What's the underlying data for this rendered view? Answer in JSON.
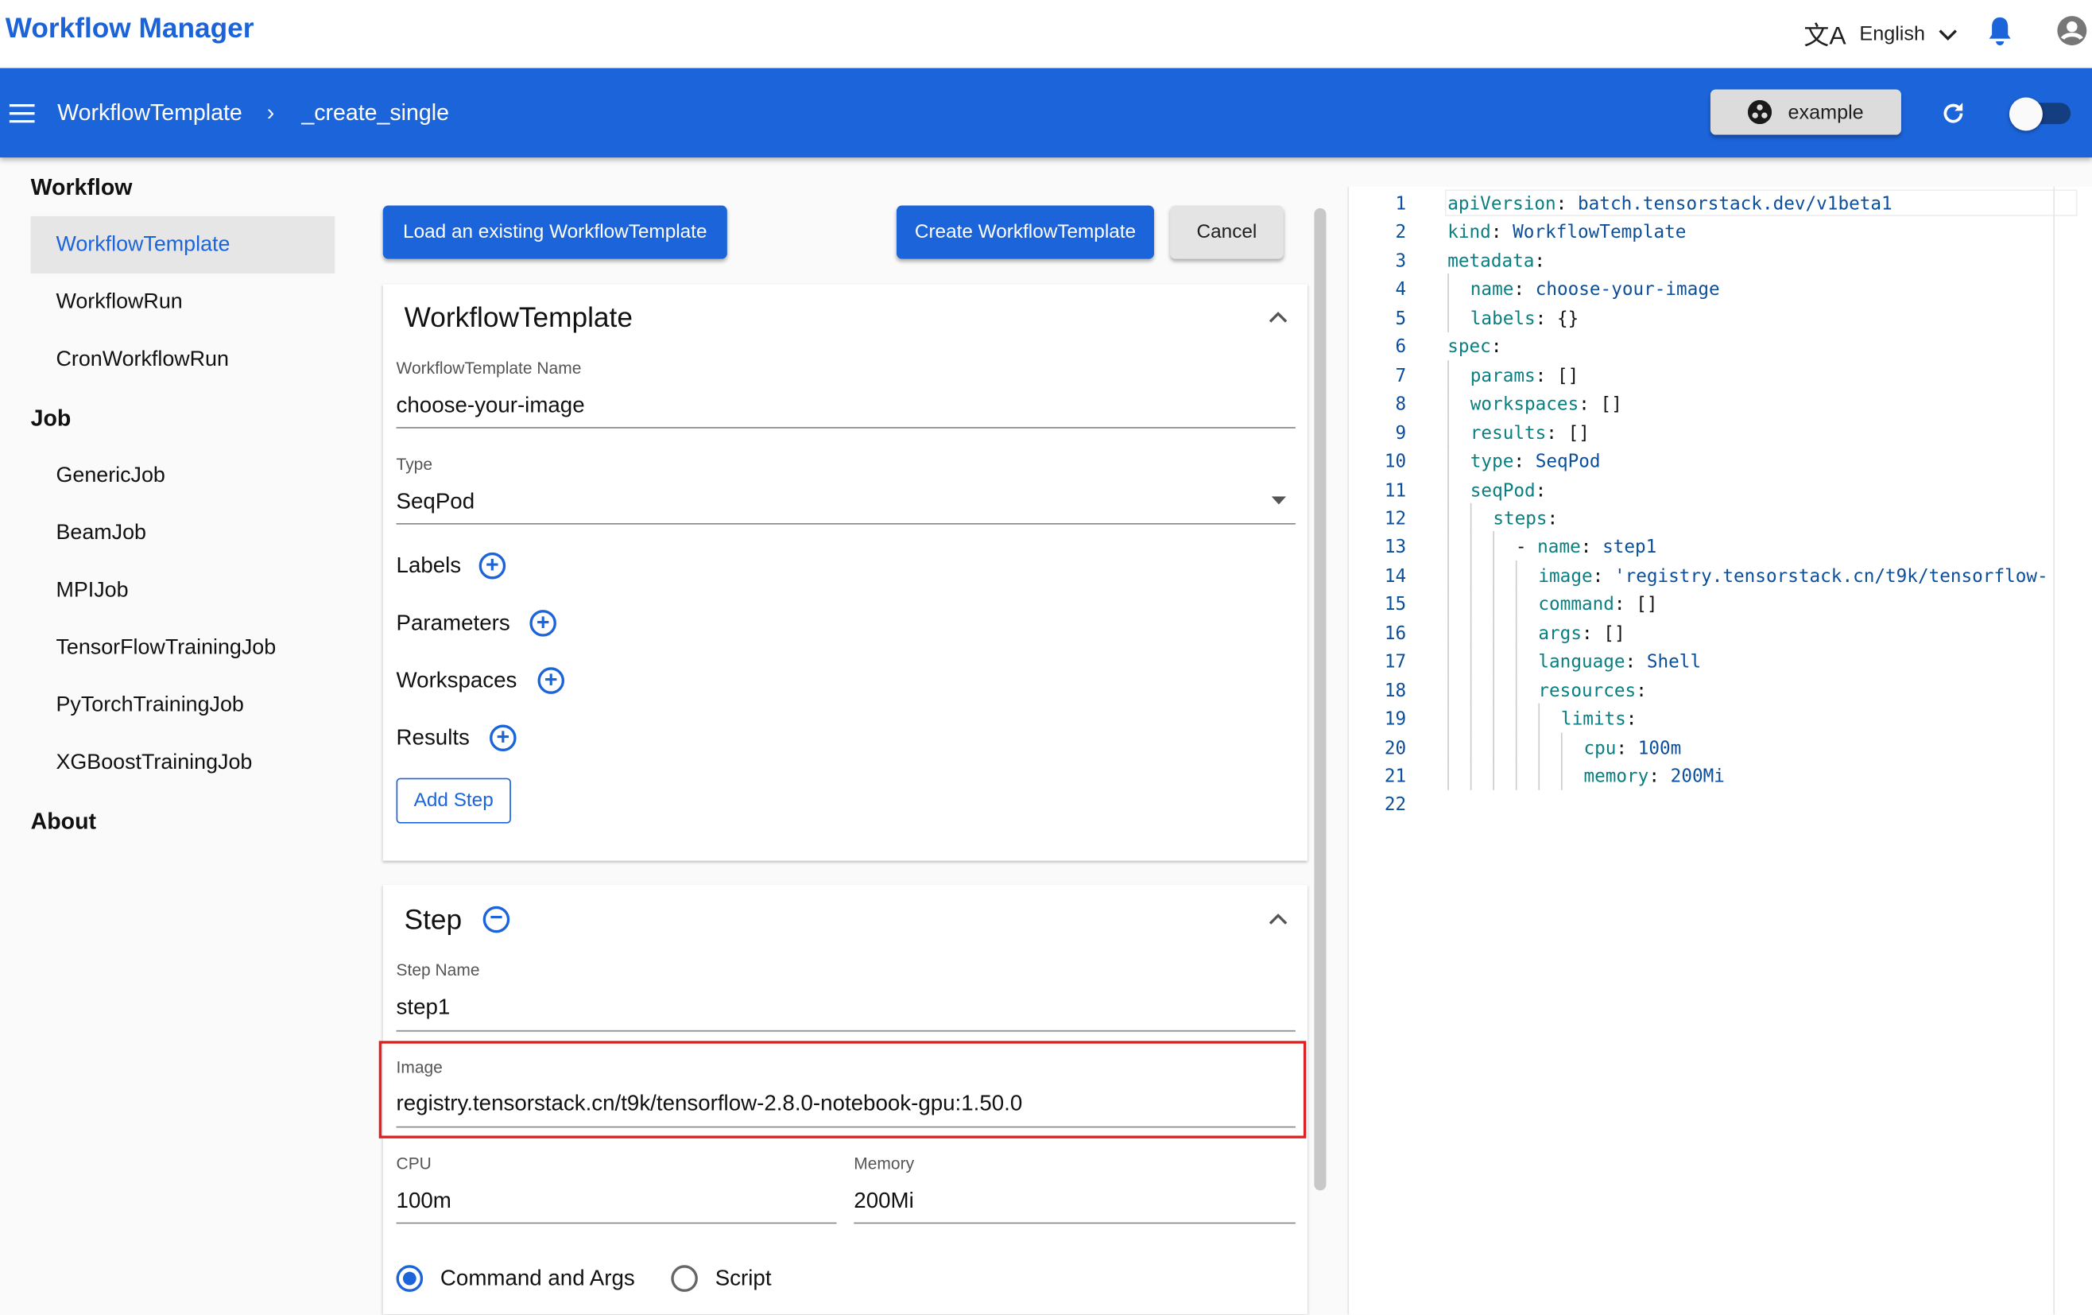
{
  "app": {
    "title": "Workflow Manager",
    "language": "English"
  },
  "icons": {
    "translate": "translate-icon",
    "chevron": "chevron-down-icon",
    "bell": "bell-icon",
    "account": "account-circle-icon",
    "menu": "menu-icon",
    "refresh": "refresh-icon",
    "project": "project-icon"
  },
  "colors": {
    "primary": "#1c64da",
    "highlight_box": "#e02020"
  },
  "header": {
    "breadcrumb": [
      "WorkflowTemplate",
      "_create_single"
    ],
    "project": "example",
    "toggle_on": false
  },
  "sidebar": {
    "sections": [
      {
        "title": "Workflow",
        "items": [
          "WorkflowTemplate",
          "WorkflowRun",
          "CronWorkflowRun"
        ]
      },
      {
        "title": "Job",
        "items": [
          "GenericJob",
          "BeamJob",
          "MPIJob",
          "TensorFlowTrainingJob",
          "PyTorchTrainingJob",
          "XGBoostTrainingJob"
        ]
      },
      {
        "title": "About",
        "items": []
      }
    ],
    "selected": "WorkflowTemplate"
  },
  "toolbar": {
    "load": "Load an existing WorkflowTemplate",
    "create": "Create WorkflowTemplate",
    "cancel": "Cancel"
  },
  "template": {
    "title": "WorkflowTemplate",
    "name_label": "WorkflowTemplate Name",
    "name": "choose-your-image",
    "type_label": "Type",
    "type": "SeqPod",
    "labels": "Labels",
    "parameters": "Parameters",
    "workspaces": "Workspaces",
    "results": "Results",
    "add_step": "Add Step"
  },
  "step": {
    "title": "Step",
    "name_label": "Step Name",
    "name": "step1",
    "image_label": "Image",
    "image": "registry.tensorstack.cn/t9k/tensorflow-2.8.0-notebook-gpu:1.50.0",
    "cpu_label": "CPU",
    "cpu": "100m",
    "memory_label": "Memory",
    "memory": "200Mi",
    "mode_options": [
      "Command and Args",
      "Script"
    ],
    "mode_selected": "Command and Args"
  },
  "yaml": [
    {
      "i": 0,
      "k": "apiVersion",
      "v": "batch.tensorstack.dev/v1beta1"
    },
    {
      "i": 0,
      "k": "kind",
      "v": "WorkflowTemplate"
    },
    {
      "i": 0,
      "k": "metadata",
      "v": ""
    },
    {
      "i": 1,
      "k": "name",
      "v": "choose-your-image"
    },
    {
      "i": 1,
      "k": "labels",
      "v": "{}",
      "plain": true
    },
    {
      "i": 0,
      "k": "spec",
      "v": ""
    },
    {
      "i": 1,
      "k": "params",
      "v": "[]",
      "plain": true
    },
    {
      "i": 1,
      "k": "workspaces",
      "v": "[]",
      "plain": true
    },
    {
      "i": 1,
      "k": "results",
      "v": "[]",
      "plain": true
    },
    {
      "i": 1,
      "k": "type",
      "v": "SeqPod"
    },
    {
      "i": 1,
      "k": "seqPod",
      "v": ""
    },
    {
      "i": 2,
      "k": "steps",
      "v": ""
    },
    {
      "i": 3,
      "k": "name",
      "v": "step1",
      "dash": true
    },
    {
      "i": 4,
      "k": "image",
      "v": "'registry.tensorstack.cn/t9k/tensorflow-"
    },
    {
      "i": 4,
      "k": "command",
      "v": "[]",
      "plain": true
    },
    {
      "i": 4,
      "k": "args",
      "v": "[]",
      "plain": true
    },
    {
      "i": 4,
      "k": "language",
      "v": "Shell"
    },
    {
      "i": 4,
      "k": "resources",
      "v": ""
    },
    {
      "i": 5,
      "k": "limits",
      "v": ""
    },
    {
      "i": 6,
      "k": "cpu",
      "v": "100m"
    },
    {
      "i": 6,
      "k": "memory",
      "v": "200Mi"
    },
    {
      "i": 0,
      "k": "",
      "v": ""
    }
  ]
}
